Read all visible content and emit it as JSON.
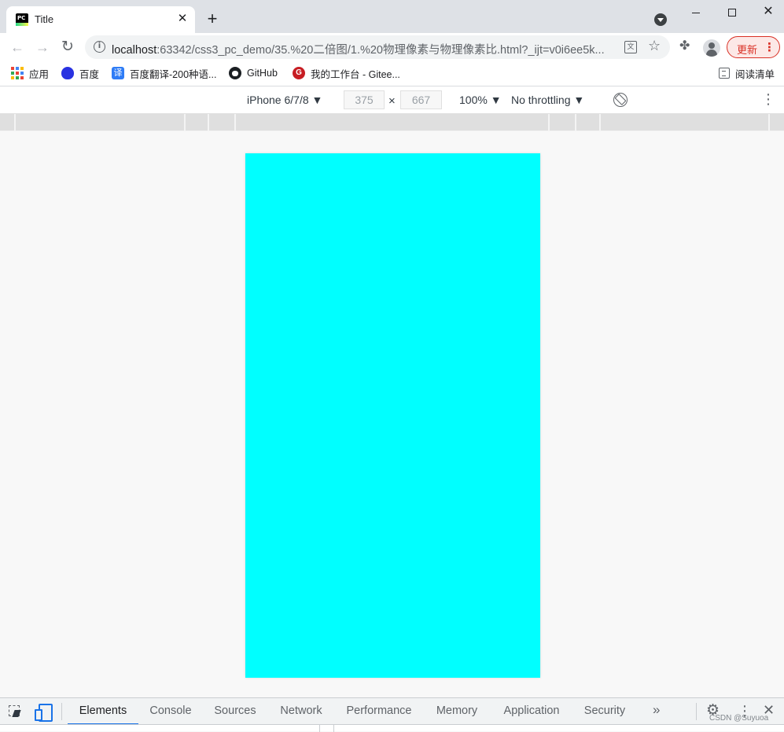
{
  "browser": {
    "tab": {
      "title": "Title",
      "close_glyph": "✕"
    },
    "new_tab_glyph": "+",
    "window_controls": {
      "close_glyph": "✕"
    },
    "nav": {
      "back_glyph": "←",
      "forward_glyph": "→",
      "reload_glyph": "↻"
    },
    "address": {
      "host": "localhost",
      "rest": ":63342/css3_pc_demo/35.%20二倍图/1.%20物理像素与物理像素比.html?_ijt=v0i6ee5k..."
    },
    "update_button": {
      "label": "更新",
      "menu_glyph": "⋮"
    },
    "icons": {
      "translate": "translate-icon",
      "star": "star-icon",
      "extensions": "puzzle-icon",
      "profile": "profile-icon"
    },
    "glyphs": {
      "star": "☆",
      "extensions": "✤",
      "info": "i",
      "translate": "文"
    }
  },
  "bookmarks": [
    {
      "label": "应用",
      "icon": "apps-grid-icon"
    },
    {
      "label": "百度",
      "icon": "baidu-icon"
    },
    {
      "label": "百度翻译-200种语...",
      "icon": "fanyi-icon",
      "icon_glyph": "译"
    },
    {
      "label": "GitHub",
      "icon": "github-icon"
    },
    {
      "label": "我的工作台 - Gitee...",
      "icon": "gitee-icon",
      "icon_glyph": "G"
    },
    {
      "label": "阅读清单",
      "icon": "reading-list-icon"
    }
  ],
  "device_toolbar": {
    "device": "iPhone 6/7/8 ▼",
    "width": "375",
    "times": "×",
    "height": "667",
    "zoom": "100% ▼",
    "throttling": "No throttling ▼",
    "more_glyph": "⋮"
  },
  "viewport": {
    "background": "#00ffff"
  },
  "devtools": {
    "tabs": [
      "Elements",
      "Console",
      "Sources",
      "Network",
      "Performance",
      "Memory",
      "Application",
      "Security"
    ],
    "active_tab": "Elements",
    "more_tabs_glyph": "»",
    "settings_glyph": "⚙",
    "menu_glyph": "⋮",
    "close_glyph": "✕"
  },
  "watermark": "CSDN @Suyuoa",
  "colors": {
    "accent": "#1a73e8",
    "update_red": "#d93025",
    "apps_grid": [
      "#ea4335",
      "#4285f4",
      "#fbbc05",
      "#34a853",
      "#ea4335",
      "#4285f4",
      "#fbbc05",
      "#34a853",
      "#ea4335"
    ]
  }
}
